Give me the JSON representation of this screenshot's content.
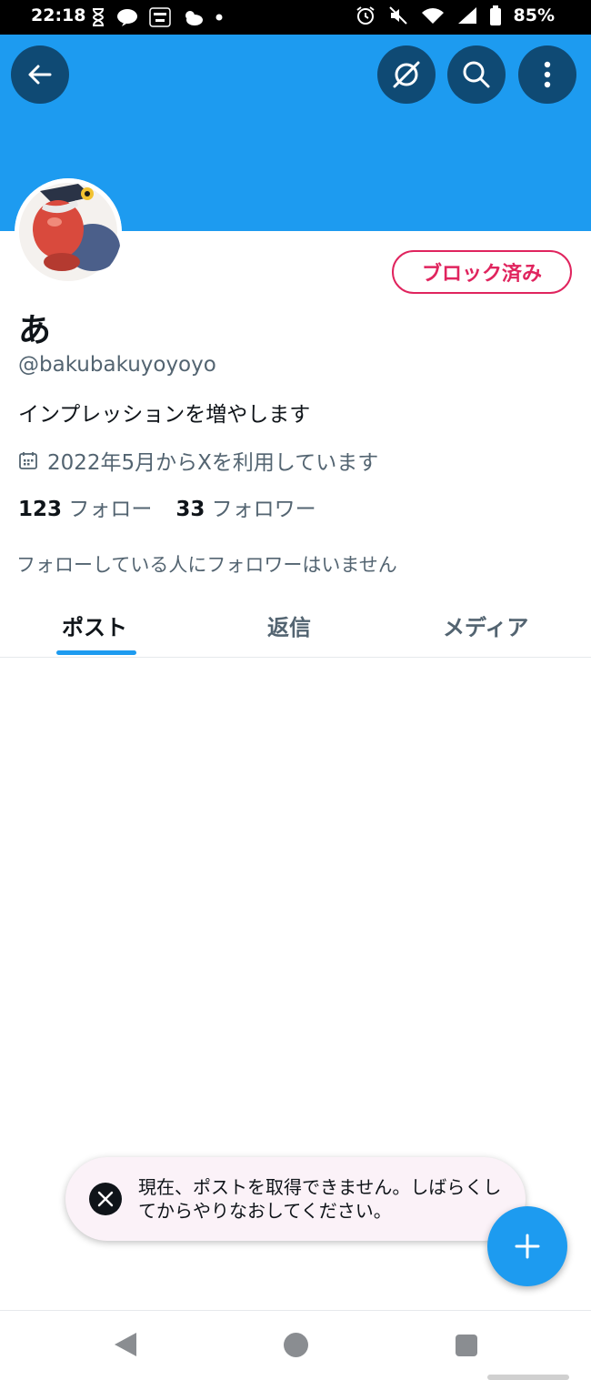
{
  "status_bar": {
    "time": "22:18",
    "battery": "85%",
    "icons": [
      "hourglass-icon",
      "line-icon",
      "manga-up-icon",
      "weather-icon",
      "dot-icon",
      "alarm-icon",
      "mute-icon",
      "wifi-icon",
      "signal-icon",
      "battery-icon"
    ]
  },
  "header": {
    "back_icon": "arrow-left-icon",
    "grok_icon": "grok-icon",
    "search_icon": "search-icon",
    "more_icon": "more-vertical-icon",
    "banner_color": "#1d9bf0"
  },
  "profile": {
    "blocked_label": "ブロック済み",
    "display_name": "あ",
    "handle": "@bakubakuyoyoyo",
    "bio": "インプレッションを増やします",
    "joined": "2022年5月からXを利用しています",
    "following_count": "123",
    "following_label": "フォロー",
    "followers_count": "33",
    "followers_label": "フォロワー",
    "mutuals_note": "フォローしている人にフォロワーはいません"
  },
  "tabs": [
    {
      "label": "ポスト",
      "active": true
    },
    {
      "label": "返信",
      "active": false
    },
    {
      "label": "メディア",
      "active": false
    }
  ],
  "toast": {
    "message": "現在、ポストを取得できません。しばらくしてからやりなおしてください。"
  },
  "colors": {
    "accent": "#1d9bf0",
    "blocked": "#e0245e"
  }
}
